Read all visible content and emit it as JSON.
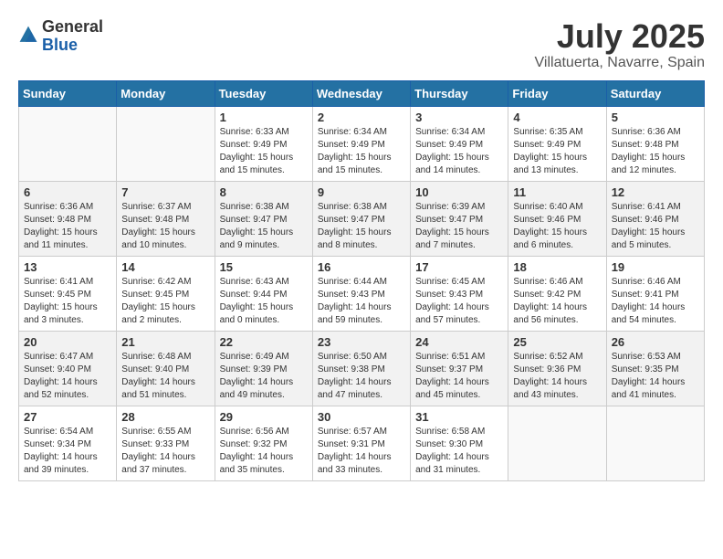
{
  "header": {
    "logo_general": "General",
    "logo_blue": "Blue",
    "month": "July 2025",
    "location": "Villatuerta, Navarre, Spain"
  },
  "weekdays": [
    "Sunday",
    "Monday",
    "Tuesday",
    "Wednesday",
    "Thursday",
    "Friday",
    "Saturday"
  ],
  "weeks": [
    {
      "shaded": false,
      "days": [
        {
          "num": "",
          "info": ""
        },
        {
          "num": "",
          "info": ""
        },
        {
          "num": "1",
          "info": "Sunrise: 6:33 AM\nSunset: 9:49 PM\nDaylight: 15 hours and 15 minutes."
        },
        {
          "num": "2",
          "info": "Sunrise: 6:34 AM\nSunset: 9:49 PM\nDaylight: 15 hours and 15 minutes."
        },
        {
          "num": "3",
          "info": "Sunrise: 6:34 AM\nSunset: 9:49 PM\nDaylight: 15 hours and 14 minutes."
        },
        {
          "num": "4",
          "info": "Sunrise: 6:35 AM\nSunset: 9:49 PM\nDaylight: 15 hours and 13 minutes."
        },
        {
          "num": "5",
          "info": "Sunrise: 6:36 AM\nSunset: 9:48 PM\nDaylight: 15 hours and 12 minutes."
        }
      ]
    },
    {
      "shaded": true,
      "days": [
        {
          "num": "6",
          "info": "Sunrise: 6:36 AM\nSunset: 9:48 PM\nDaylight: 15 hours and 11 minutes."
        },
        {
          "num": "7",
          "info": "Sunrise: 6:37 AM\nSunset: 9:48 PM\nDaylight: 15 hours and 10 minutes."
        },
        {
          "num": "8",
          "info": "Sunrise: 6:38 AM\nSunset: 9:47 PM\nDaylight: 15 hours and 9 minutes."
        },
        {
          "num": "9",
          "info": "Sunrise: 6:38 AM\nSunset: 9:47 PM\nDaylight: 15 hours and 8 minutes."
        },
        {
          "num": "10",
          "info": "Sunrise: 6:39 AM\nSunset: 9:47 PM\nDaylight: 15 hours and 7 minutes."
        },
        {
          "num": "11",
          "info": "Sunrise: 6:40 AM\nSunset: 9:46 PM\nDaylight: 15 hours and 6 minutes."
        },
        {
          "num": "12",
          "info": "Sunrise: 6:41 AM\nSunset: 9:46 PM\nDaylight: 15 hours and 5 minutes."
        }
      ]
    },
    {
      "shaded": false,
      "days": [
        {
          "num": "13",
          "info": "Sunrise: 6:41 AM\nSunset: 9:45 PM\nDaylight: 15 hours and 3 minutes."
        },
        {
          "num": "14",
          "info": "Sunrise: 6:42 AM\nSunset: 9:45 PM\nDaylight: 15 hours and 2 minutes."
        },
        {
          "num": "15",
          "info": "Sunrise: 6:43 AM\nSunset: 9:44 PM\nDaylight: 15 hours and 0 minutes."
        },
        {
          "num": "16",
          "info": "Sunrise: 6:44 AM\nSunset: 9:43 PM\nDaylight: 14 hours and 59 minutes."
        },
        {
          "num": "17",
          "info": "Sunrise: 6:45 AM\nSunset: 9:43 PM\nDaylight: 14 hours and 57 minutes."
        },
        {
          "num": "18",
          "info": "Sunrise: 6:46 AM\nSunset: 9:42 PM\nDaylight: 14 hours and 56 minutes."
        },
        {
          "num": "19",
          "info": "Sunrise: 6:46 AM\nSunset: 9:41 PM\nDaylight: 14 hours and 54 minutes."
        }
      ]
    },
    {
      "shaded": true,
      "days": [
        {
          "num": "20",
          "info": "Sunrise: 6:47 AM\nSunset: 9:40 PM\nDaylight: 14 hours and 52 minutes."
        },
        {
          "num": "21",
          "info": "Sunrise: 6:48 AM\nSunset: 9:40 PM\nDaylight: 14 hours and 51 minutes."
        },
        {
          "num": "22",
          "info": "Sunrise: 6:49 AM\nSunset: 9:39 PM\nDaylight: 14 hours and 49 minutes."
        },
        {
          "num": "23",
          "info": "Sunrise: 6:50 AM\nSunset: 9:38 PM\nDaylight: 14 hours and 47 minutes."
        },
        {
          "num": "24",
          "info": "Sunrise: 6:51 AM\nSunset: 9:37 PM\nDaylight: 14 hours and 45 minutes."
        },
        {
          "num": "25",
          "info": "Sunrise: 6:52 AM\nSunset: 9:36 PM\nDaylight: 14 hours and 43 minutes."
        },
        {
          "num": "26",
          "info": "Sunrise: 6:53 AM\nSunset: 9:35 PM\nDaylight: 14 hours and 41 minutes."
        }
      ]
    },
    {
      "shaded": false,
      "days": [
        {
          "num": "27",
          "info": "Sunrise: 6:54 AM\nSunset: 9:34 PM\nDaylight: 14 hours and 39 minutes."
        },
        {
          "num": "28",
          "info": "Sunrise: 6:55 AM\nSunset: 9:33 PM\nDaylight: 14 hours and 37 minutes."
        },
        {
          "num": "29",
          "info": "Sunrise: 6:56 AM\nSunset: 9:32 PM\nDaylight: 14 hours and 35 minutes."
        },
        {
          "num": "30",
          "info": "Sunrise: 6:57 AM\nSunset: 9:31 PM\nDaylight: 14 hours and 33 minutes."
        },
        {
          "num": "31",
          "info": "Sunrise: 6:58 AM\nSunset: 9:30 PM\nDaylight: 14 hours and 31 minutes."
        },
        {
          "num": "",
          "info": ""
        },
        {
          "num": "",
          "info": ""
        }
      ]
    }
  ]
}
